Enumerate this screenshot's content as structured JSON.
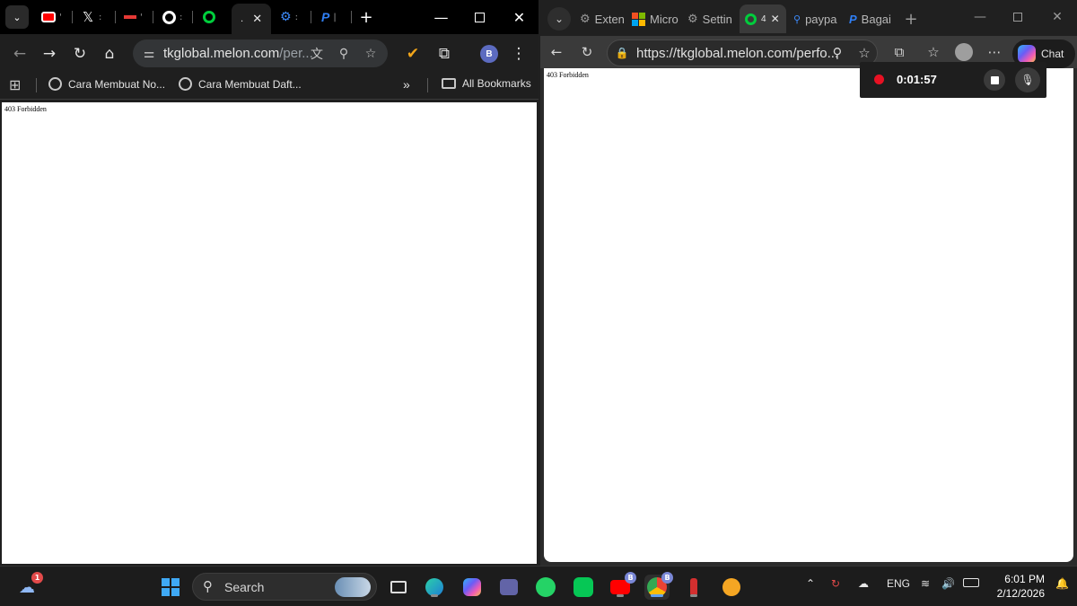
{
  "chrome": {
    "tabs": [
      {
        "name": "youtube-tab",
        "marker": "'"
      },
      {
        "name": "x-tab",
        "marker": ":"
      },
      {
        "name": "red-tab",
        "marker": "'"
      },
      {
        "name": "chrome-tab",
        "marker": ":"
      },
      {
        "name": "melon-tab",
        "marker": "."
      },
      {
        "name": "settings-tab",
        "marker": ":"
      },
      {
        "name": "paypal-tab",
        "marker": "|"
      }
    ],
    "url_main": "tkglobal.melon.com",
    "url_rest": "/per...",
    "bookmarks": [
      {
        "label": "Cara Membuat No..."
      },
      {
        "label": "Cara Membuat Daft..."
      }
    ],
    "all_bookmarks": "All Bookmarks",
    "overflow": "»",
    "profile_initial": "B",
    "page_text": "403 Forbidden"
  },
  "edge": {
    "tabs": [
      {
        "label": "Exten"
      },
      {
        "label": "Micro"
      },
      {
        "label": "Settin"
      },
      {
        "label": "4"
      },
      {
        "label": "paypa"
      },
      {
        "label": "Bagai"
      }
    ],
    "url": "https://tkglobal.melon.com/perfo...",
    "chat_label": "Chat",
    "page_text": "403 Forbidden"
  },
  "recorder": {
    "time": "0:01:57"
  },
  "taskbar": {
    "weather_badge": "1",
    "search_label": "Search",
    "youtube_badge": "B",
    "chrome_badge": "B",
    "lang": "ENG",
    "time": "6:01 PM",
    "date": "2/12/2026"
  }
}
